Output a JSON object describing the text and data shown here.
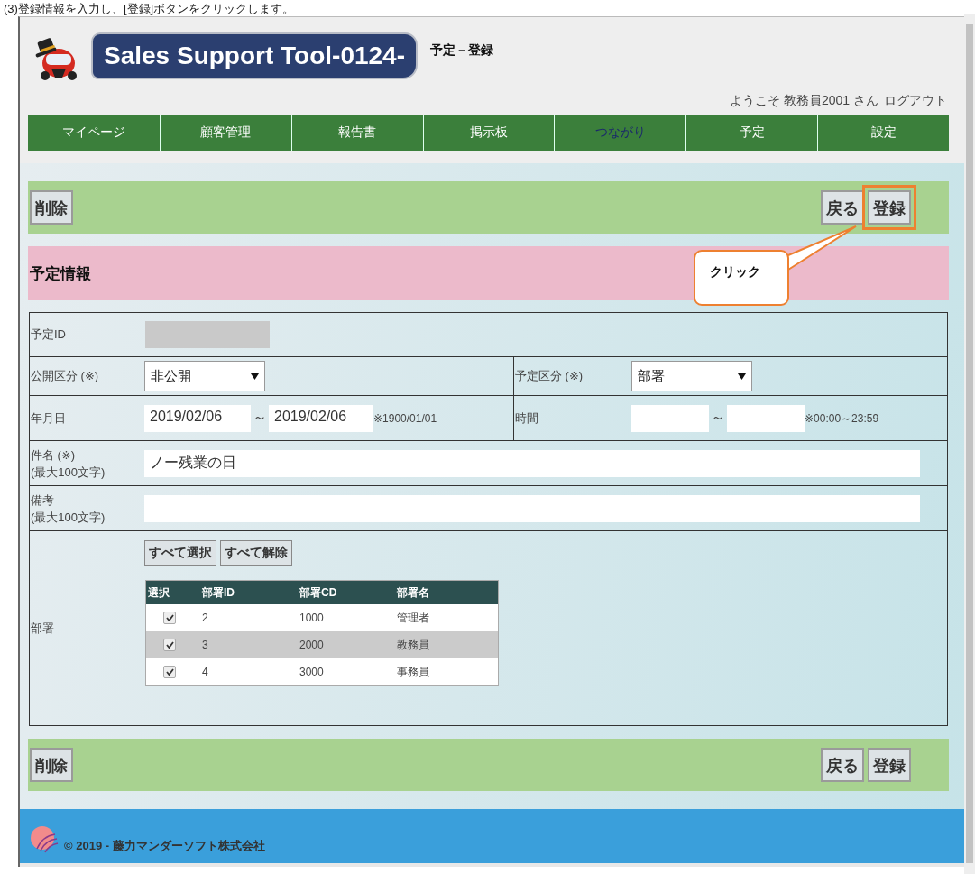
{
  "caption": "(3)登録情報を入力し、[登録]ボタンをクリックします。",
  "header": {
    "app_title": "Sales Support Tool-0124-",
    "page_title": "予定－登録",
    "welcome": "ようこそ 教務員2001 さん",
    "logout": "ログアウト"
  },
  "nav": [
    {
      "label": "マイページ",
      "visited": false
    },
    {
      "label": "顧客管理",
      "visited": false
    },
    {
      "label": "報告書",
      "visited": false
    },
    {
      "label": "掲示板",
      "visited": false
    },
    {
      "label": "つながり",
      "visited": true
    },
    {
      "label": "予定",
      "visited": false
    },
    {
      "label": "設定",
      "visited": false
    }
  ],
  "top_actions": {
    "left": [
      {
        "label": "削除"
      }
    ],
    "right": [
      {
        "label": "戻る",
        "highlighted": false
      },
      {
        "label": "登録",
        "highlighted": true
      }
    ]
  },
  "callout": {
    "text": "クリック"
  },
  "section_title": "予定情報",
  "form": {
    "schedule_id": {
      "label": "予定ID"
    },
    "visibility": {
      "label": "公開区分 (※)",
      "value": "非公開"
    },
    "schedule_type": {
      "label": "予定区分 (※)",
      "value": "部署"
    },
    "date": {
      "label": "年月日",
      "from": "2019/02/06",
      "separator": "～",
      "to": "2019/02/06",
      "note": "※1900/01/01"
    },
    "time": {
      "label": "時間",
      "separator": "～",
      "note": "※00:00～23:59"
    },
    "subject": {
      "label": "件名 (※)",
      "hint": "(最大100文字)",
      "value": "ノー残業の日"
    },
    "remarks": {
      "label": "備考",
      "hint": "(最大100文字)"
    },
    "departments": {
      "label": "部署",
      "select_all": "すべて選択",
      "clear_all": "すべて解除",
      "columns": [
        "選択",
        "部署ID",
        "部署CD",
        "部署名"
      ],
      "rows": [
        {
          "checked": true,
          "id": "2",
          "code": "1000",
          "name": "管理者"
        },
        {
          "checked": true,
          "id": "3",
          "code": "2000",
          "name": "教務員"
        },
        {
          "checked": true,
          "id": "4",
          "code": "3000",
          "name": "事務員"
        }
      ]
    }
  },
  "bottom_actions": {
    "left": [
      {
        "label": "削除"
      }
    ],
    "right": [
      {
        "label": "戻る",
        "highlighted": false
      },
      {
        "label": "登録",
        "highlighted": false
      }
    ]
  },
  "footer": {
    "copyright": "© 2019 - 藤力マンダーソフト株式会社"
  }
}
